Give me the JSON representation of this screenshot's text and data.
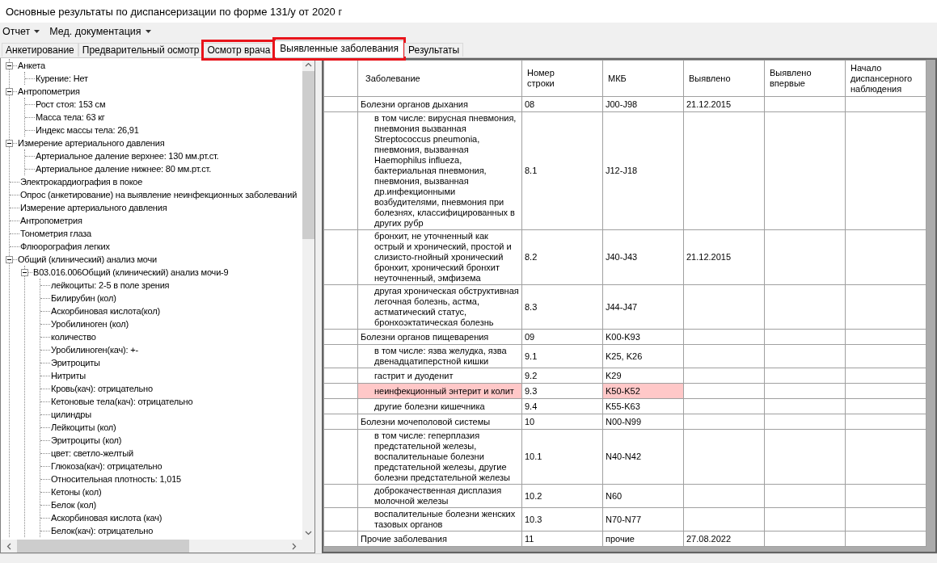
{
  "window": {
    "title": "Основные результаты по диспансеризации по форме 131/у от 2020 г"
  },
  "menu": [
    {
      "label": "Отчет"
    },
    {
      "label": "Мед. документация"
    }
  ],
  "tabs": [
    {
      "label": "Анкетирование",
      "selected": false,
      "highlighted": false
    },
    {
      "label": "Предварительный осмотр",
      "selected": false,
      "highlighted": false
    },
    {
      "label": "Осмотр врача",
      "selected": false,
      "highlighted": true
    },
    {
      "label": "Выявленные заболевания",
      "selected": true,
      "highlighted": true
    },
    {
      "label": "Результаты",
      "selected": false,
      "highlighted": false
    }
  ],
  "tree": [
    {
      "label": "Анкета",
      "expanded": true,
      "children": [
        {
          "label": "Курение: Нет"
        }
      ]
    },
    {
      "label": "Антропометрия",
      "expanded": true,
      "children": [
        {
          "label": "Рост стоя: 153 см"
        },
        {
          "label": "Масса тела: 63 кг"
        },
        {
          "label": "Индекс массы тела: 26,91"
        }
      ]
    },
    {
      "label": "Измерение артериального давления",
      "expanded": true,
      "children": [
        {
          "label": "Артериальное даление верхнее: 130 мм.рт.ст."
        },
        {
          "label": "Артериальное даление нижнее: 80 мм.рт.ст."
        }
      ]
    },
    {
      "label": "Электрокардиография в покое"
    },
    {
      "label": "Опрос (анкетирование) на выявление неинфекционных заболеваний"
    },
    {
      "label": "Измерение артериального давления"
    },
    {
      "label": "Антропометрия"
    },
    {
      "label": "Тонометрия глаза"
    },
    {
      "label": "Флюорография легких"
    },
    {
      "label": "Общий (клинический) анализ мочи",
      "expanded": true,
      "children": [
        {
          "label": "B03.016.006Общий (клинический) анализ мочи-9",
          "expanded": true,
          "children": [
            {
              "label": "лейкоциты: 2-5 в поле зрения"
            },
            {
              "label": "Билирубин (кол)"
            },
            {
              "label": "Аскорбиновая кислота(кол)"
            },
            {
              "label": "Уробилиноген (кол)"
            },
            {
              "label": "количество"
            },
            {
              "label": "Уробилиноген(кач): +-"
            },
            {
              "label": "Эритроциты"
            },
            {
              "label": "Нитриты"
            },
            {
              "label": "Кровь(кач): отрицательно"
            },
            {
              "label": "Кетоновые тела(кач): отрицательно"
            },
            {
              "label": "цилиндры"
            },
            {
              "label": "Лейкоциты (кол)"
            },
            {
              "label": "Эритроциты (кол)"
            },
            {
              "label": "цвет: светло-желтый"
            },
            {
              "label": "Глюкоза(кач): отрицательно"
            },
            {
              "label": "Относительная плотность: 1,015"
            },
            {
              "label": "Кетоны (кол)"
            },
            {
              "label": "Белок (кол)"
            },
            {
              "label": "Аскорбиновая кислота (кач)"
            },
            {
              "label": "Белок(кач): отрицательно"
            }
          ]
        }
      ]
    }
  ],
  "table": {
    "columns": [
      "Заболевание",
      "Номер строки",
      "МКБ",
      "Выявлено",
      "Выявлено впервые",
      "Начало диспансерного наблюдения"
    ],
    "rows": [
      {
        "kind": "group",
        "flagged": false,
        "disease": "Болезни органов дыхания",
        "line": "08",
        "icd": "J00-J98",
        "detected": "21.12.2015"
      },
      {
        "kind": "sub",
        "flagged": false,
        "disease": "в том числе: вирусная пневмония, пневмония вызванная Streptococcus pneumonia, пневмония, вызванная Haemophilus influeza, бактериальная пневмония, пневмония, вызванная др.инфекционными возбудителями, пневмония при болезнях, классифицированных в других рубр",
        "line": "8.1",
        "icd": "J12-J18"
      },
      {
        "kind": "sub",
        "flagged": false,
        "disease": "бронхит, не уточненный как острый и хронический, простой и слизисто-гнойный хронический бронхит, хронический бронхит неуточненный, эмфизема",
        "line": "8.2",
        "icd": "J40-J43",
        "detected": "21.12.2015"
      },
      {
        "kind": "sub",
        "flagged": false,
        "disease": "другая хроническая обструктивная легочная болезнь, астма, астматический статус, бронхоэктатическая болезнь",
        "line": "8.3",
        "icd": "J44-J47"
      },
      {
        "kind": "group",
        "flagged": false,
        "disease": "Болезни органов пищеварения",
        "line": "09",
        "icd": "K00-K93"
      },
      {
        "kind": "sub",
        "flagged": false,
        "disease": "в том числе: язва желудка, язва двенадцатиперстной кишки",
        "line": "9.1",
        "icd": "K25, K26"
      },
      {
        "kind": "sub",
        "flagged": false,
        "disease": "гастрит и дуоденит",
        "line": "9.2",
        "icd": "K29"
      },
      {
        "kind": "sub",
        "flagged": true,
        "disease": "неинфекционный энтерит и колит",
        "line": "9.3",
        "icd": "K50-K52"
      },
      {
        "kind": "sub",
        "flagged": false,
        "disease": "другие болезни кишечника",
        "line": "9.4",
        "icd": "K55-K63"
      },
      {
        "kind": "group",
        "flagged": false,
        "disease": "Болезни мочеполовой системы",
        "line": "10",
        "icd": "N00-N99"
      },
      {
        "kind": "sub",
        "flagged": false,
        "disease": "в том числе: геперплазия предстательной железы, воспалительнаые болезни предстательной железы, другие болезни предстательной железы",
        "line": "10.1",
        "icd": "N40-N42"
      },
      {
        "kind": "sub",
        "flagged": false,
        "disease": "доброкачественная дисплазия молочной железы",
        "line": "10.2",
        "icd": "N60"
      },
      {
        "kind": "sub",
        "flagged": false,
        "disease": "воспалительные болезни женских тазовых органов",
        "line": "10.3",
        "icd": "N70-N77"
      },
      {
        "kind": "group",
        "flagged": false,
        "disease": "Прочие заболевания",
        "line": "11",
        "icd": "прочие",
        "detected": "27.08.2022"
      }
    ]
  }
}
